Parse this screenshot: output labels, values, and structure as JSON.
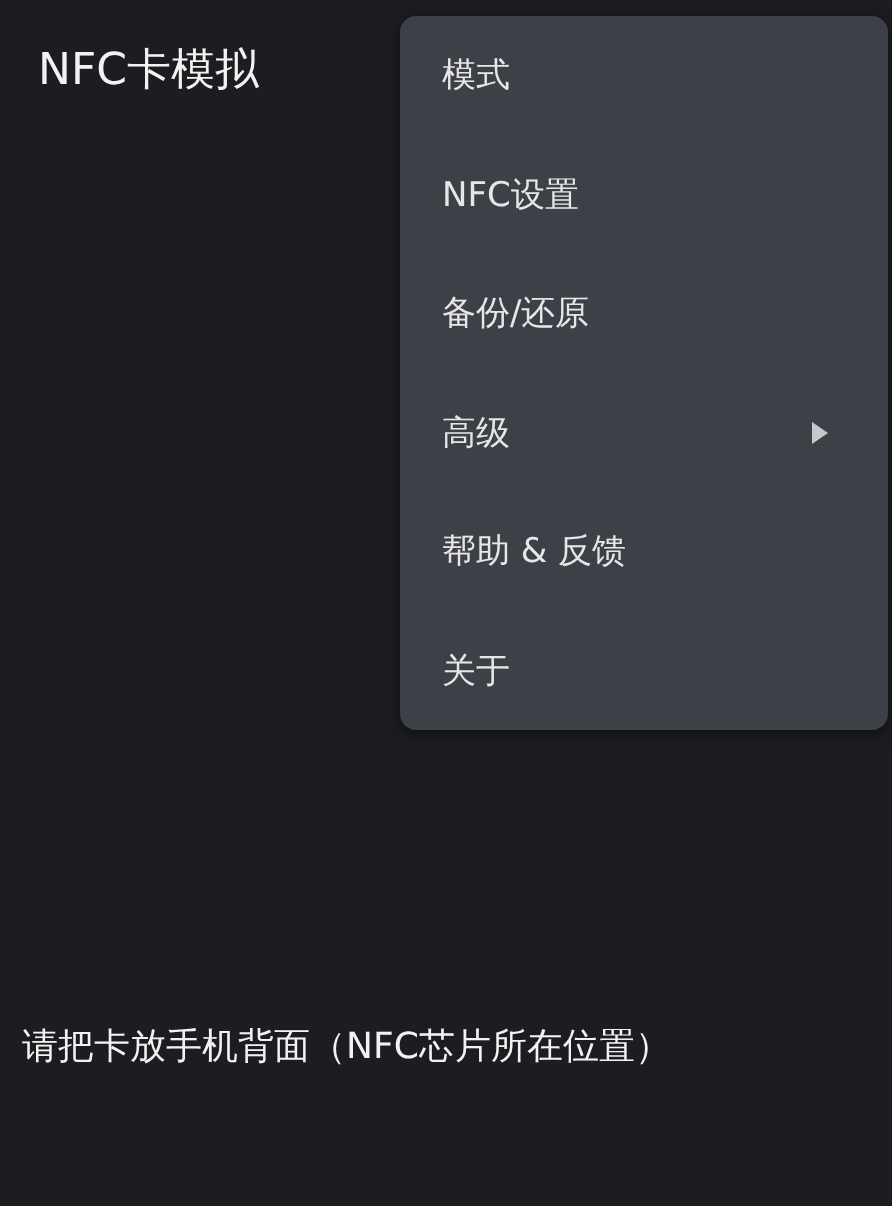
{
  "app_bar": {
    "title": "NFC卡模拟"
  },
  "menu": {
    "items": [
      {
        "label": "模式",
        "has_submenu": false
      },
      {
        "label": "NFC设置",
        "has_submenu": false
      },
      {
        "label": "备份/还原",
        "has_submenu": false
      },
      {
        "label": "高级",
        "has_submenu": true
      },
      {
        "label": "帮助 & 反馈",
        "has_submenu": false
      },
      {
        "label": "关于",
        "has_submenu": false
      }
    ]
  },
  "message": "请把卡放手机背面（NFC芯片所在位置）"
}
